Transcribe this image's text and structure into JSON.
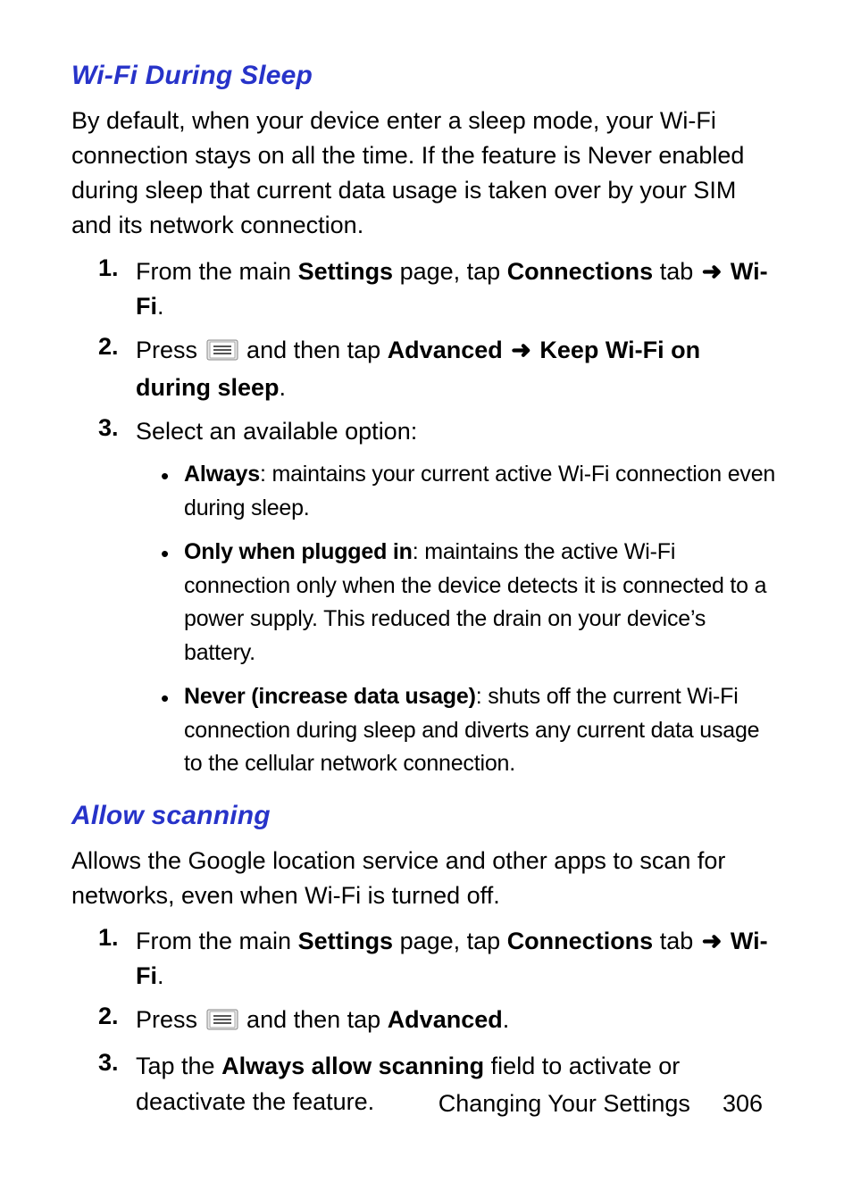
{
  "section1": {
    "heading": "Wi-Fi During Sleep",
    "intro": "By default, when your device enter a sleep mode, your Wi-Fi connection stays on all the time. If the feature is Never enabled during sleep that current data usage is taken over by your SIM and its network connection.",
    "step1": {
      "num": "1.",
      "t1": "From the main ",
      "b1": "Settings",
      "t2": " page, tap ",
      "b2": "Connections",
      "t3": " tab ",
      "arrow": "➜",
      "b3": " Wi-Fi",
      "t4": "."
    },
    "step2": {
      "num": "2.",
      "t1": "Press ",
      "t2": " and then tap ",
      "b1": "Advanced ",
      "arrow": "➜",
      "b2": " Keep Wi-Fi on during sleep",
      "t3": "."
    },
    "step3": {
      "num": "3.",
      "t1": "Select an available option:"
    },
    "bullets": {
      "b1_label": "Always",
      "b1_text": ": maintains your current active Wi-Fi connection even during sleep.",
      "b2_label": "Only when plugged in",
      "b2_text": ": maintains the active Wi-Fi connection only when the device detects it is connected to a power supply. This reduced the drain on your device’s battery.",
      "b3_label": "Never (increase data usage)",
      "b3_text": ": shuts off the current Wi-Fi connection during sleep and diverts any current data usage to the cellular network connection."
    }
  },
  "section2": {
    "heading": "Allow scanning",
    "intro": "Allows the Google location service and other apps to scan for networks, even when Wi-Fi is turned off.",
    "step1": {
      "num": "1.",
      "t1": "From the main ",
      "b1": "Settings",
      "t2": " page, tap ",
      "b2": "Connections",
      "t3": " tab ",
      "arrow": "➜",
      "b3": " Wi-Fi",
      "t4": "."
    },
    "step2": {
      "num": "2.",
      "t1": "Press ",
      "t2": " and then tap ",
      "b1": "Advanced",
      "t3": "."
    },
    "step3": {
      "num": "3.",
      "t1": "Tap the ",
      "b1": "Always allow scanning",
      "t2": " field to activate or deactivate the feature."
    }
  },
  "footer": {
    "title": "Changing Your Settings",
    "page": "306"
  },
  "bullet_char": "•"
}
